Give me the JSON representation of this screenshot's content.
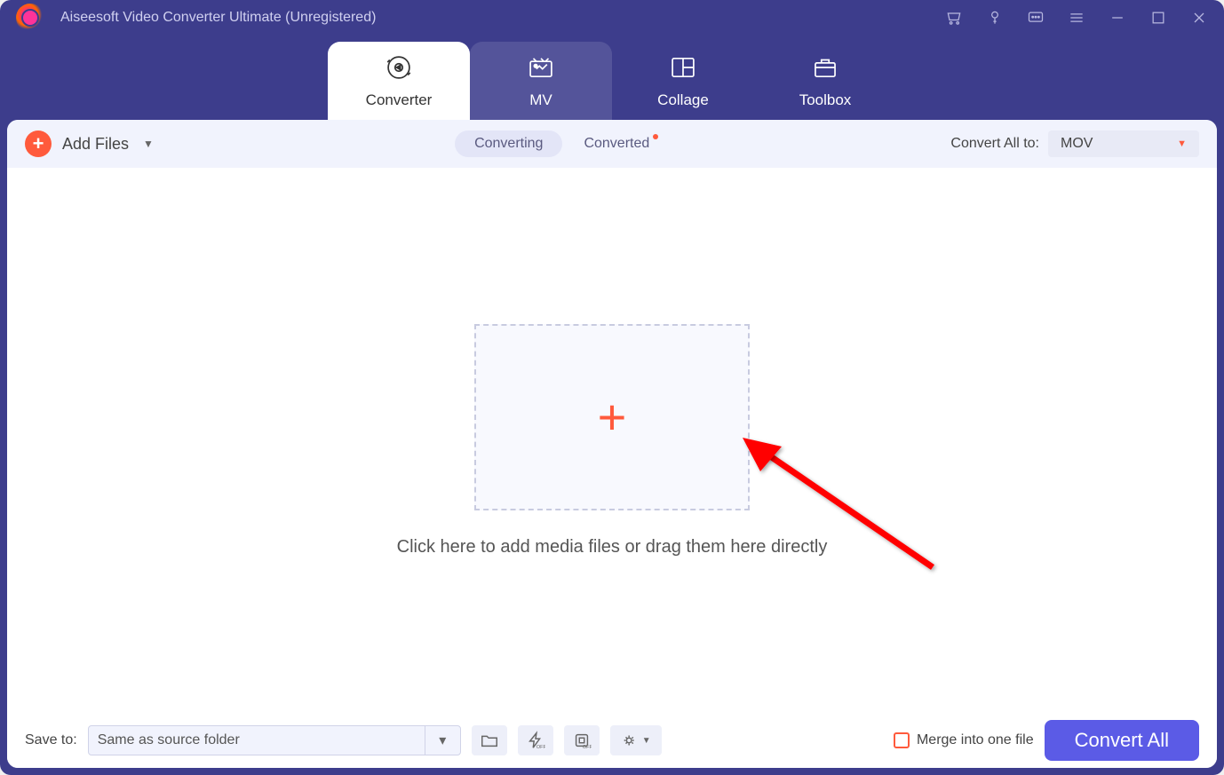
{
  "app": {
    "title": "Aiseesoft Video Converter Ultimate (Unregistered)"
  },
  "nav": {
    "tabs": [
      {
        "label": "Converter"
      },
      {
        "label": "MV"
      },
      {
        "label": "Collage"
      },
      {
        "label": "Toolbox"
      }
    ]
  },
  "toolbar": {
    "add_files_label": "Add Files",
    "filter_converting": "Converting",
    "filter_converted": "Converted",
    "convert_all_label": "Convert All to:",
    "format_selected": "MOV"
  },
  "main": {
    "drop_hint": "Click here to add media files or drag them here directly"
  },
  "bottom": {
    "save_to_label": "Save to:",
    "save_to_value": "Same as source folder",
    "merge_label": "Merge into one file",
    "convert_button": "Convert All"
  }
}
